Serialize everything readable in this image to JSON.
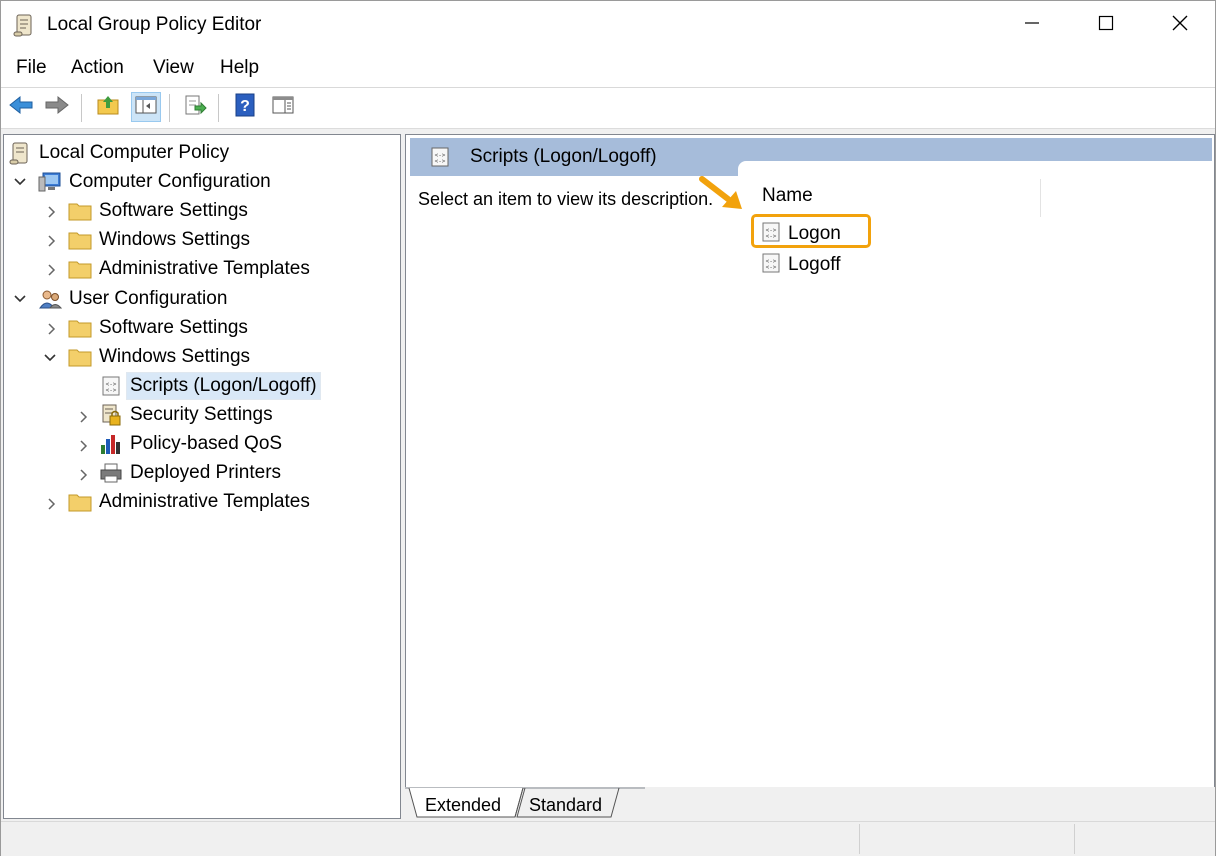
{
  "window": {
    "title": "Local Group Policy Editor"
  },
  "menu": {
    "items": [
      "File",
      "Action",
      "View",
      "Help"
    ]
  },
  "toolbar": {
    "buttons": [
      "back-arrow-icon",
      "forward-arrow-icon",
      "up-folder-icon",
      "show-hide-tree-icon",
      "export-list-icon",
      "help-icon",
      "properties-view-icon"
    ]
  },
  "tree": {
    "root": "Local Computer Policy",
    "computer_configuration": {
      "label": "Computer Configuration",
      "children": [
        "Software Settings",
        "Windows Settings",
        "Administrative Templates"
      ]
    },
    "user_configuration": {
      "label": "User Configuration",
      "software_settings": "Software Settings",
      "windows_settings": {
        "label": "Windows Settings",
        "children": [
          "Scripts (Logon/Logoff)",
          "Security Settings",
          "Policy-based QoS",
          "Deployed Printers"
        ]
      },
      "administrative_templates": "Administrative Templates"
    }
  },
  "details": {
    "header": "Scripts (Logon/Logoff)",
    "description_prompt": "Select an item to view its description.",
    "column_name": "Name",
    "items": [
      "Logon",
      "Logoff"
    ],
    "highlight_color": "#f2a20c"
  },
  "tabs": [
    "Extended",
    "Standard"
  ]
}
